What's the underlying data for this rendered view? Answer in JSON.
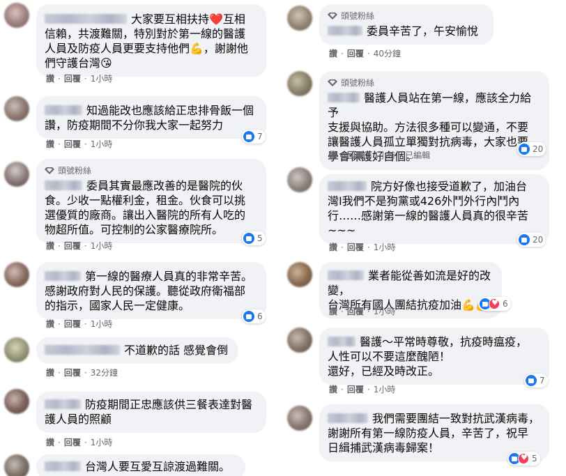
{
  "badge_label": "頭號粉絲",
  "actions": {
    "like": "讚",
    "reply": "回覆",
    "sep": "·",
    "edited": "已編輯"
  },
  "left": [
    {
      "lines": [
        "大家要互相扶持❤️互相",
        "信賴，共渡難關，特別對於第一線的醫護",
        "人員及防疫人員更要支持他們💪，謝謝他",
        "們守護台灣😘"
      ],
      "time": "1小時",
      "reactions": null
    },
    {
      "lines": [
        "知過能改也應該給正忠排骨飯一個",
        "讚，防疫期間不分你我大家一起努力"
      ],
      "time": "1小時",
      "reactions": "7"
    },
    {
      "badge": true,
      "lines": [
        "委員其實最應改善的是醫院的伙",
        "食。少收一點權利金，租金。伙食可以挑",
        "選優質的廠商。讓出入醫院的所有人吃的",
        "物超所值。可控制的公家醫療院所。"
      ],
      "time": "1小時",
      "reactions": "5"
    },
    {
      "lines": [
        "第一線的醫療人員真的非常辛苦。",
        "感謝政府對人民的保護。聽從政府衛福部",
        "的指示，國家人民一定健康。"
      ],
      "time": "1小時",
      "reactions": "6"
    },
    {
      "lines": [
        "不道歉的話 感覺會倒"
      ],
      "time": "32分鐘",
      "reactions": null
    },
    {
      "lines": [
        "防疫期間正忠應該供三餐表達對醫",
        "護人員的照顧"
      ],
      "time": "1小時",
      "reactions": null
    },
    {
      "lines": [
        "台灣人要互愛互諒渡過難關。"
      ],
      "time": "",
      "reactions": null
    }
  ],
  "right": [
    {
      "badge": true,
      "lines": [
        "委員辛苦了，午安愉悅"
      ],
      "time": "40分鐘",
      "reactions": null
    },
    {
      "badge": true,
      "lines": [
        "醫護人員站在第一線，應該全力給予",
        "支援與協助。方法很多種可以變通，不要",
        "讓醫護人員孤立單獨對抗病毒，大家也要",
        "學會保護好自個。"
      ],
      "time": "1小時",
      "edited": true,
      "reactions": "20"
    },
    {
      "lines": [
        "院方好像也接受道歉了，加油台",
        "灣I我們不是狗黨或426外鬥外行內鬥內",
        "行……感謝第一線的醫護人員真的很辛苦",
        "~~~"
      ],
      "time": "1小時",
      "reactions": "20"
    },
    {
      "lines": [
        "業者能從善如流是好的改變，",
        "台灣所有國人團結抗疫加油💪💪"
      ],
      "time": "1小時",
      "reactions": "6",
      "love": true
    },
    {
      "lines": [
        "醫護～平常時尊敬，抗疫時瘟疫，",
        "人性可以不要這麼醜陋！",
        "還好，已經及時改正。"
      ],
      "time": "1小時",
      "reactions": "7"
    },
    {
      "lines": [
        "我們需要團結一致對抗武漢病毒，",
        "謝謝所有第一線防疫人員，辛苦了，祝早",
        "日緝捕武漢病毒歸案！"
      ],
      "time": "",
      "reactions": "5",
      "love": true
    }
  ]
}
